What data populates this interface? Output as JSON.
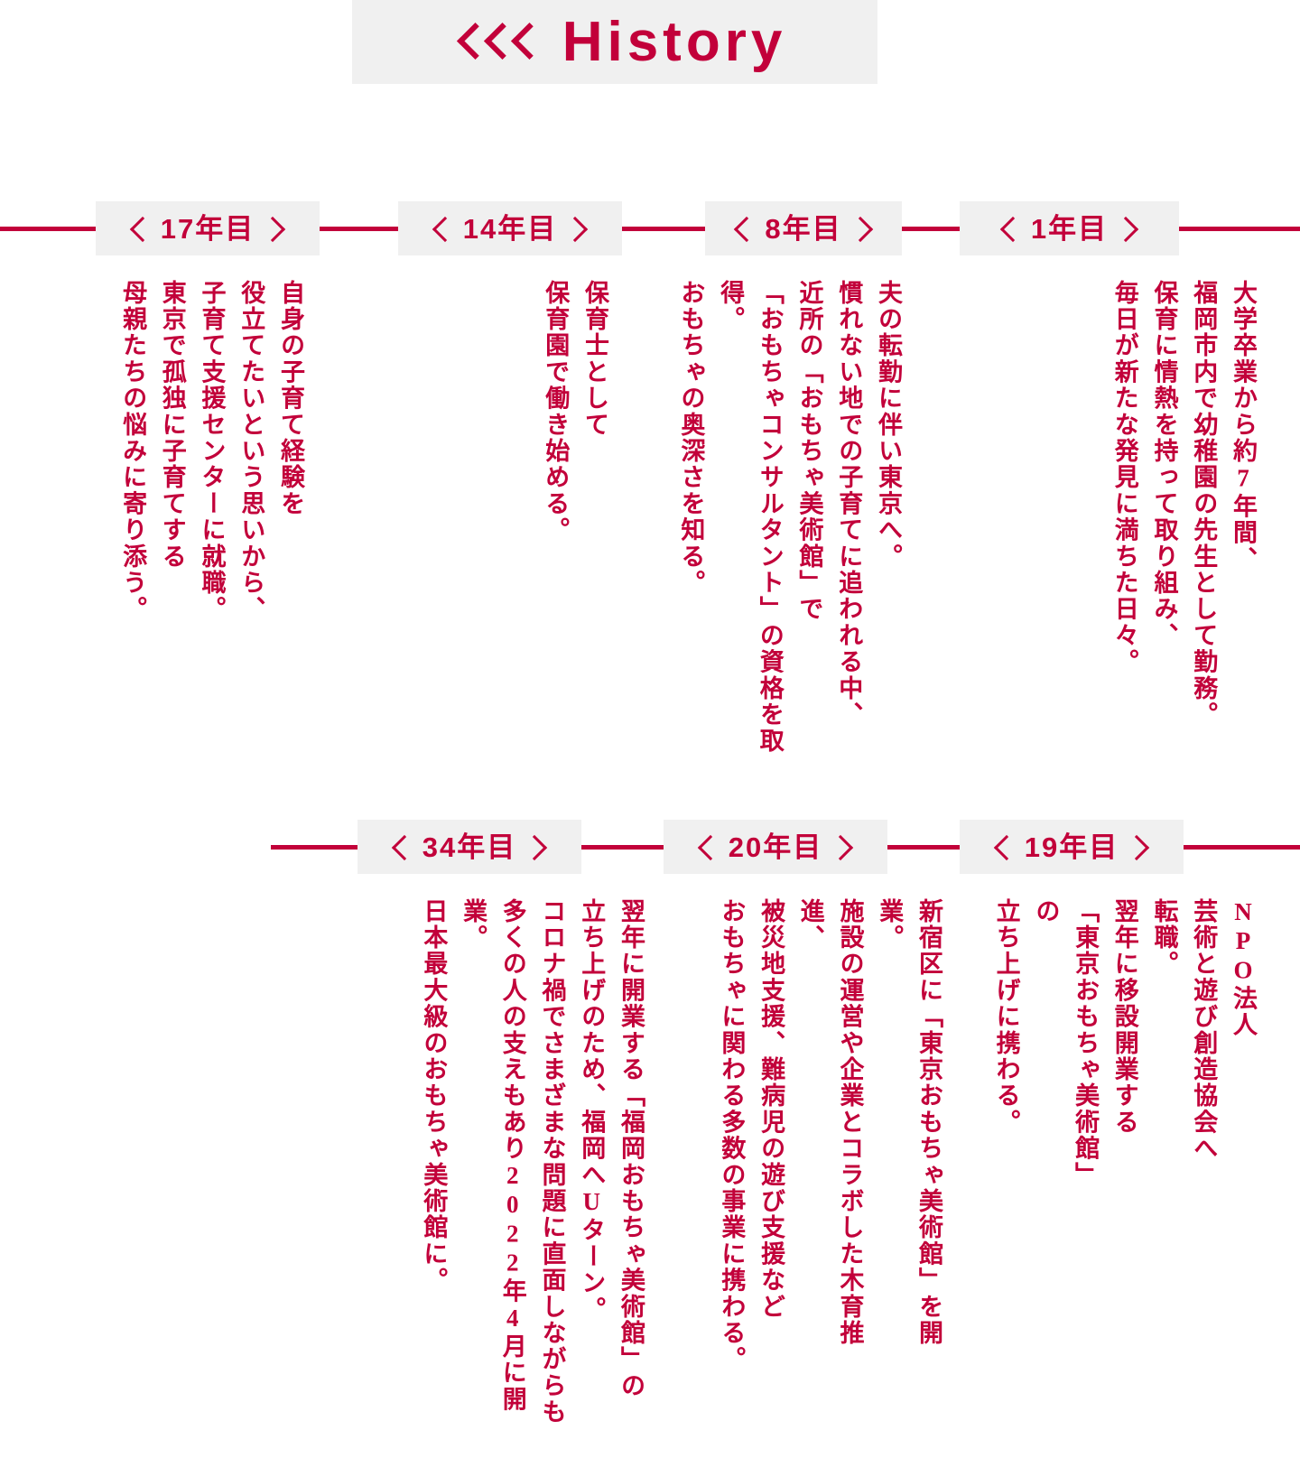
{
  "header": {
    "title": "History",
    "chevron_icon": "triple-chevron-left-icon",
    "chevron_count": 3,
    "background_color": "#f0f0f0",
    "text_color": "#c2003a"
  },
  "theme": {
    "accent_color": "#c2003a",
    "badge_background": "#f0f0f0",
    "page_background": "transparent"
  },
  "timeline": {
    "rows": [
      {
        "id": "row-1",
        "rail_from": 0,
        "rail_to": 1440,
        "entries": [
          {
            "year_label": "1年目",
            "chevron_left": "chevron-left-icon",
            "chevron_right": "chevron-right-icon",
            "body": "大学卒業から約7年間、\n福岡市内で幼稚園の先生として勤務。\n保育に情熱を持って取り組み、\n毎日が新たな発見に満ちた日々。"
          },
          {
            "year_label": "8年目",
            "chevron_left": "chevron-left-icon",
            "chevron_right": "chevron-right-icon",
            "body": "夫の転勤に伴い東京へ。\n慣れない地での子育てに追われる中、\n近所の「おもちゃ美術館」で\n「おもちゃコンサルタント」の資格を取得。\nおもちゃの奥深さを知る。"
          },
          {
            "year_label": "14年目",
            "chevron_left": "chevron-left-icon",
            "chevron_right": "chevron-right-icon",
            "body": "保育士として\n保育園で働き始める。"
          },
          {
            "year_label": "17年目",
            "chevron_left": "chevron-left-icon",
            "chevron_right": "chevron-right-icon",
            "body": "自身の子育て経験を\n役立てたいという思いから、\n子育て支援センターに就職。\n東京で孤独に子育てする\n母親たちの悩みに寄り添う。"
          }
        ]
      },
      {
        "id": "row-2",
        "rail_from": 300,
        "rail_to": 1440,
        "entries": [
          {
            "year_label": "19年目",
            "chevron_left": "chevron-left-icon",
            "chevron_right": "chevron-right-icon",
            "body": "NPO法人\n芸術と遊び創造協会へ転職。\n翌年に移設開業する\n「東京おもちゃ美術館」の\n立ち上げに携わる。"
          },
          {
            "year_label": "20年目",
            "chevron_left": "chevron-left-icon",
            "chevron_right": "chevron-right-icon",
            "body": "新宿区に「東京おもちゃ美術館」を開業。\n施設の運営や企業とコラボした木育推進、\n被災地支援、難病児の遊び支援など\nおもちゃに関わる多数の事業に携わる。"
          },
          {
            "year_label": "34年目",
            "chevron_left": "chevron-left-icon",
            "chevron_right": "chevron-right-icon",
            "body": "翌年に開業する「福岡おもちゃ美術館」の\n立ち上げのため、福岡へUターン。\nコロナ禍でさまざまな問題に直面しながらも\n多くの人の支えもあり2022年4月に開業。\n日本最大級のおもちゃ美術館に。"
          }
        ]
      }
    ]
  }
}
